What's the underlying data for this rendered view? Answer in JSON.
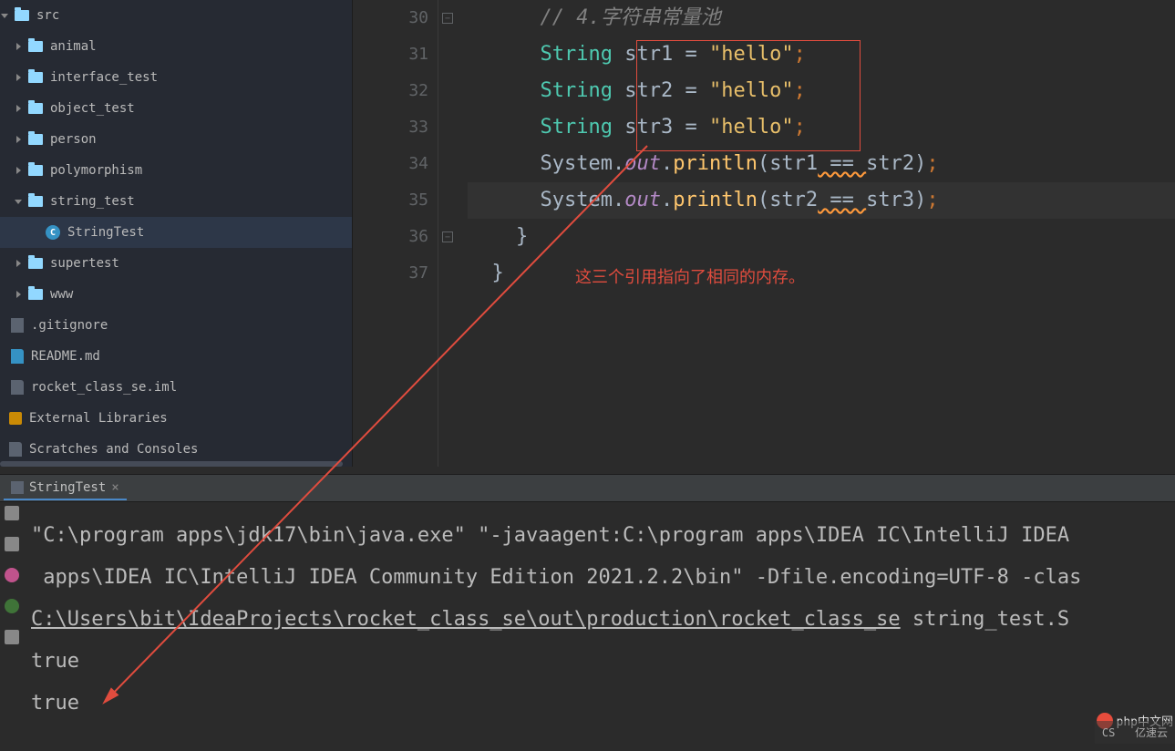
{
  "sidebar": {
    "items": [
      {
        "type": "folder",
        "label": "src",
        "arrow": "down",
        "indent": 0
      },
      {
        "type": "folder",
        "label": "animal",
        "arrow": "right",
        "indent": 15
      },
      {
        "type": "folder",
        "label": "interface_test",
        "arrow": "right",
        "indent": 15
      },
      {
        "type": "folder",
        "label": "object_test",
        "arrow": "right",
        "indent": 15
      },
      {
        "type": "folder",
        "label": "person",
        "arrow": "right",
        "indent": 15
      },
      {
        "type": "folder",
        "label": "polymorphism",
        "arrow": "right",
        "indent": 15
      },
      {
        "type": "folder",
        "label": "string_test",
        "arrow": "down",
        "indent": 15,
        "selected": false
      },
      {
        "type": "class",
        "label": "StringTest",
        "arrow": "none",
        "indent": 40,
        "selected": true
      },
      {
        "type": "folder",
        "label": "supertest",
        "arrow": "right",
        "indent": 15
      },
      {
        "type": "folder",
        "label": "www",
        "arrow": "right",
        "indent": 15
      },
      {
        "type": "gitignore",
        "label": ".gitignore",
        "arrow": "none",
        "indent": 2
      },
      {
        "type": "md",
        "label": "README.md",
        "arrow": "none",
        "indent": 2
      },
      {
        "type": "iml",
        "label": "rocket_class_se.iml",
        "arrow": "none",
        "indent": 2
      },
      {
        "type": "libs",
        "label": "External Libraries",
        "arrow": "none",
        "indent": 0
      },
      {
        "type": "scratch",
        "label": "Scratches and Consoles",
        "arrow": "none",
        "indent": 0
      }
    ]
  },
  "editor": {
    "lines": [
      {
        "num": "30"
      },
      {
        "num": "31"
      },
      {
        "num": "32"
      },
      {
        "num": "33"
      },
      {
        "num": "34"
      },
      {
        "num": "35"
      },
      {
        "num": "36"
      },
      {
        "num": "37"
      }
    ],
    "code": {
      "comment": "// 4.字符串常量池",
      "str_type": "String",
      "str1": "str1",
      "str2": "str2",
      "str3": "str3",
      "eqop": " = ",
      "hello": "\"hello\"",
      "semi": ";",
      "system": "System",
      "dot": ".",
      "out": "out",
      "println": "println",
      "lp": "(",
      "rp": ")",
      "eq2": " == ",
      "cbrace": "}"
    },
    "annotation": "这三个引用指向了相同的内存。"
  },
  "run": {
    "tab_label": "StringTest",
    "close": "×",
    "line1a": "\"C:\\program apps\\jdk17\\bin\\java.exe\" \"-javaagent:C:\\program apps\\IDEA IC\\IntelliJ IDEA",
    "line2a": " apps\\IDEA IC\\IntelliJ IDEA Community Edition 2021.2.2\\bin\" -Dfile.encoding=UTF-8 -clas",
    "line3_path": "C:\\Users\\bit\\IdeaProjects\\rocket_class_se\\out\\production\\rocket_class_se",
    "line3_rest": " string_test.S",
    "out1": "true",
    "out2": "true"
  },
  "watermark": {
    "text1": "CS",
    "text2": "php中文网",
    "text3": "亿速云"
  }
}
